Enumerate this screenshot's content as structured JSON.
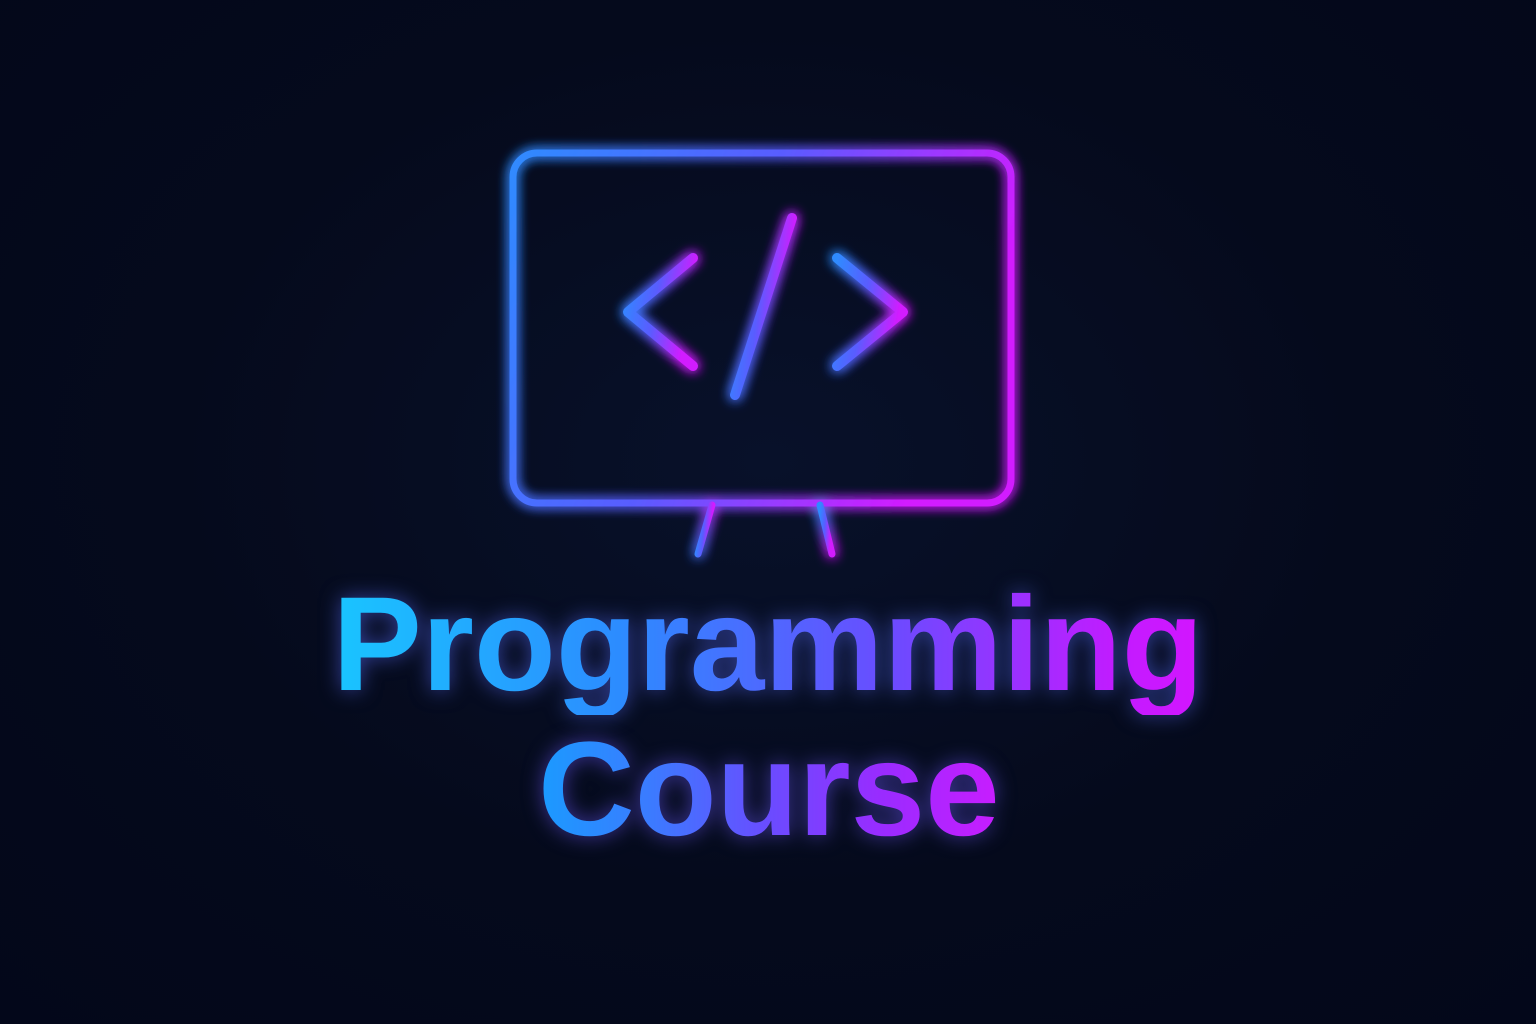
{
  "background_color": "#050a1c",
  "icon": {
    "name": "monitor-code-icon",
    "glyph": "</>"
  },
  "colors": {
    "cyan": "#15d2ff",
    "blue": "#2c8cff",
    "violet": "#6a4cff",
    "magenta": "#e111ff"
  },
  "title": {
    "line1": "Programming",
    "line2": "Course"
  }
}
